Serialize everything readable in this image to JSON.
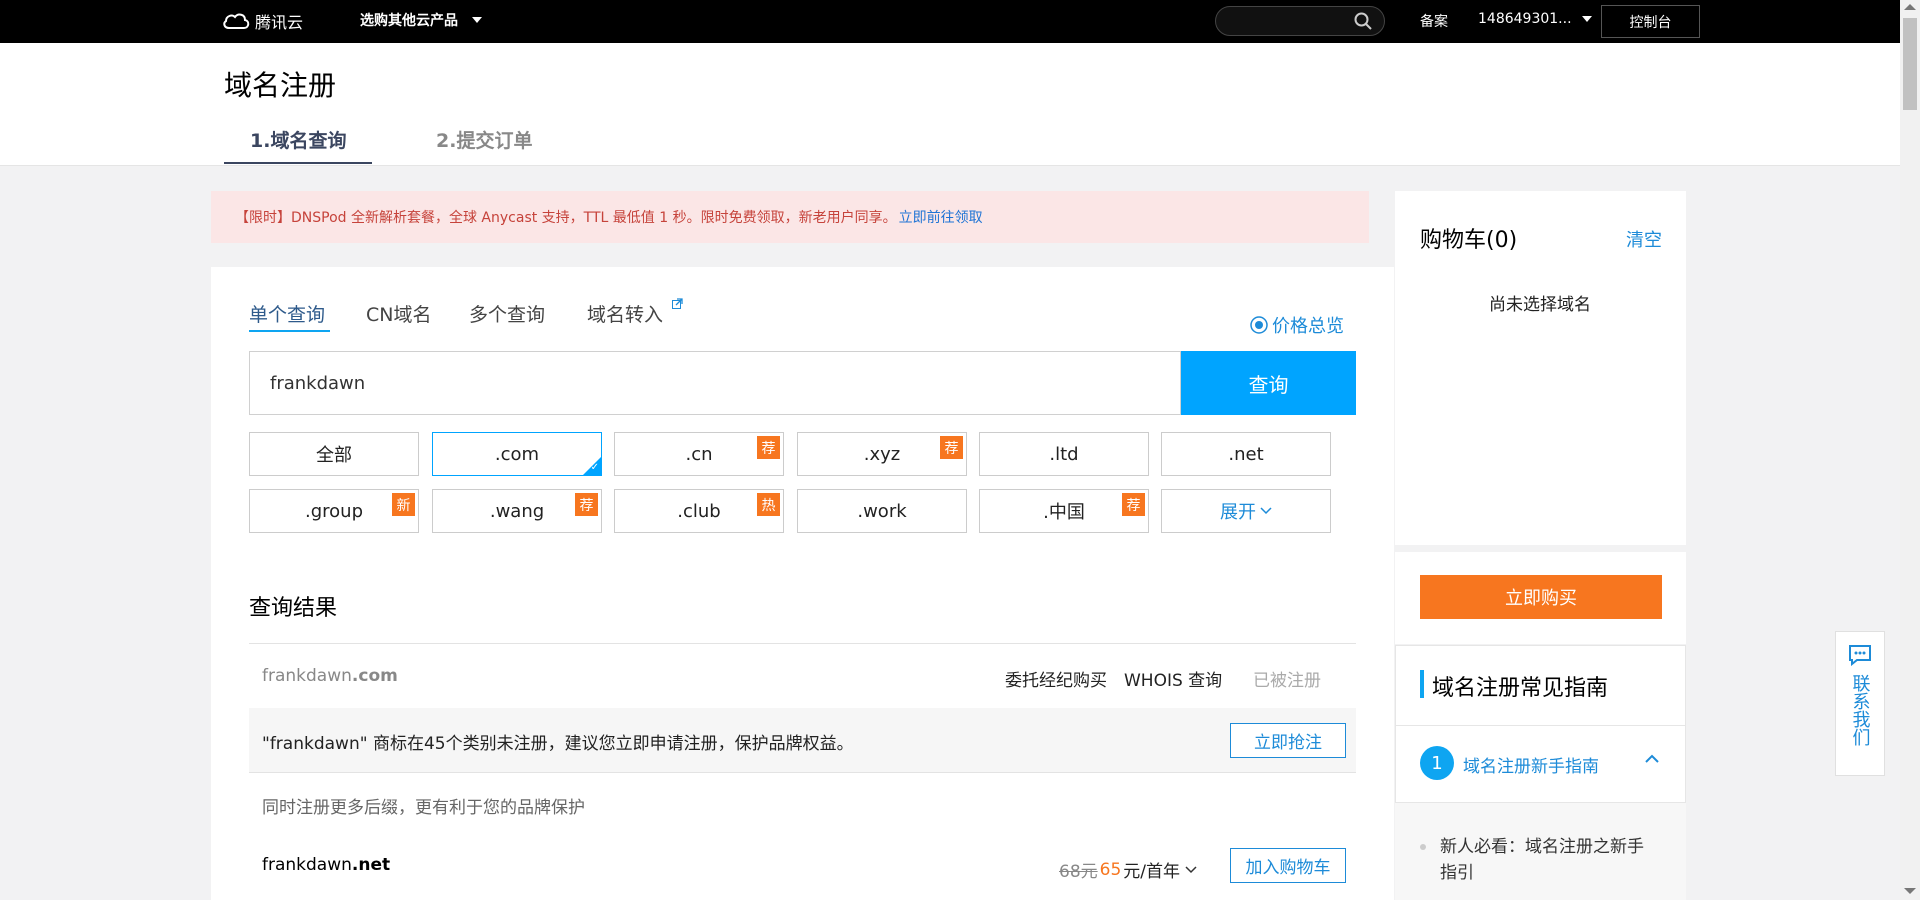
{
  "topbar": {
    "logo_text": "腾讯云",
    "products_label": "选购其他云产品",
    "beian": "备案",
    "account": "148649301...",
    "console": "控制台"
  },
  "header": {
    "title": "域名注册",
    "steps": [
      "1.域名查询",
      "2.提交订单"
    ]
  },
  "alert": {
    "text": "【限时】DNSPod 全新解析套餐，全球 Anycast 支持，TTL 最低值 1 秒。限时免费领取，新老用户同享。",
    "link": "立即前往领取"
  },
  "query": {
    "tabs": [
      "单个查询",
      "CN域名",
      "多个查询",
      "域名转入"
    ],
    "price_overview": "价格总览",
    "input_value": "frankdawn",
    "search_button": "查询",
    "suffixes_row1": [
      {
        "label": "全部",
        "badge": ""
      },
      {
        "label": ".com",
        "badge": ""
      },
      {
        "label": ".cn",
        "badge": "荐"
      },
      {
        "label": ".xyz",
        "badge": "荐"
      },
      {
        "label": ".ltd",
        "badge": ""
      },
      {
        "label": ".net",
        "badge": ""
      }
    ],
    "suffixes_row2": [
      {
        "label": ".group",
        "badge": "新"
      },
      {
        "label": ".wang",
        "badge": "荐"
      },
      {
        "label": ".club",
        "badge": "热"
      },
      {
        "label": ".work",
        "badge": ""
      },
      {
        "label": ".中国",
        "badge": "荐"
      },
      {
        "label": "展开",
        "badge": ""
      }
    ]
  },
  "results": {
    "title": "查询结果",
    "first": {
      "name": "frankdawn",
      "tld": ".com",
      "broker": "委托经纪购买",
      "whois": "WHOIS 查询",
      "status": "已被注册"
    },
    "trademark": {
      "text": "\"frankdawn\" 商标在45个类别未注册，建议您立即申请注册，保护品牌权益。",
      "button": "立即抢注"
    },
    "more_suffix_note": "同时注册更多后缀，更有利于您的品牌保护",
    "second": {
      "name": "frankdawn",
      "tld": ".net",
      "old_price": "68元",
      "new_price": "65",
      "unit": "元/首年",
      "button": "加入购物车"
    }
  },
  "cart": {
    "title": "购物车(0)",
    "clear": "清空",
    "empty": "尚未选择域名",
    "buy": "立即购买"
  },
  "guide": {
    "title": "域名注册常见指南",
    "num": "1",
    "item": "域名注册新手指南",
    "sub": "新人必看：域名注册之新手指引"
  },
  "contact": {
    "text": "联系我们"
  }
}
